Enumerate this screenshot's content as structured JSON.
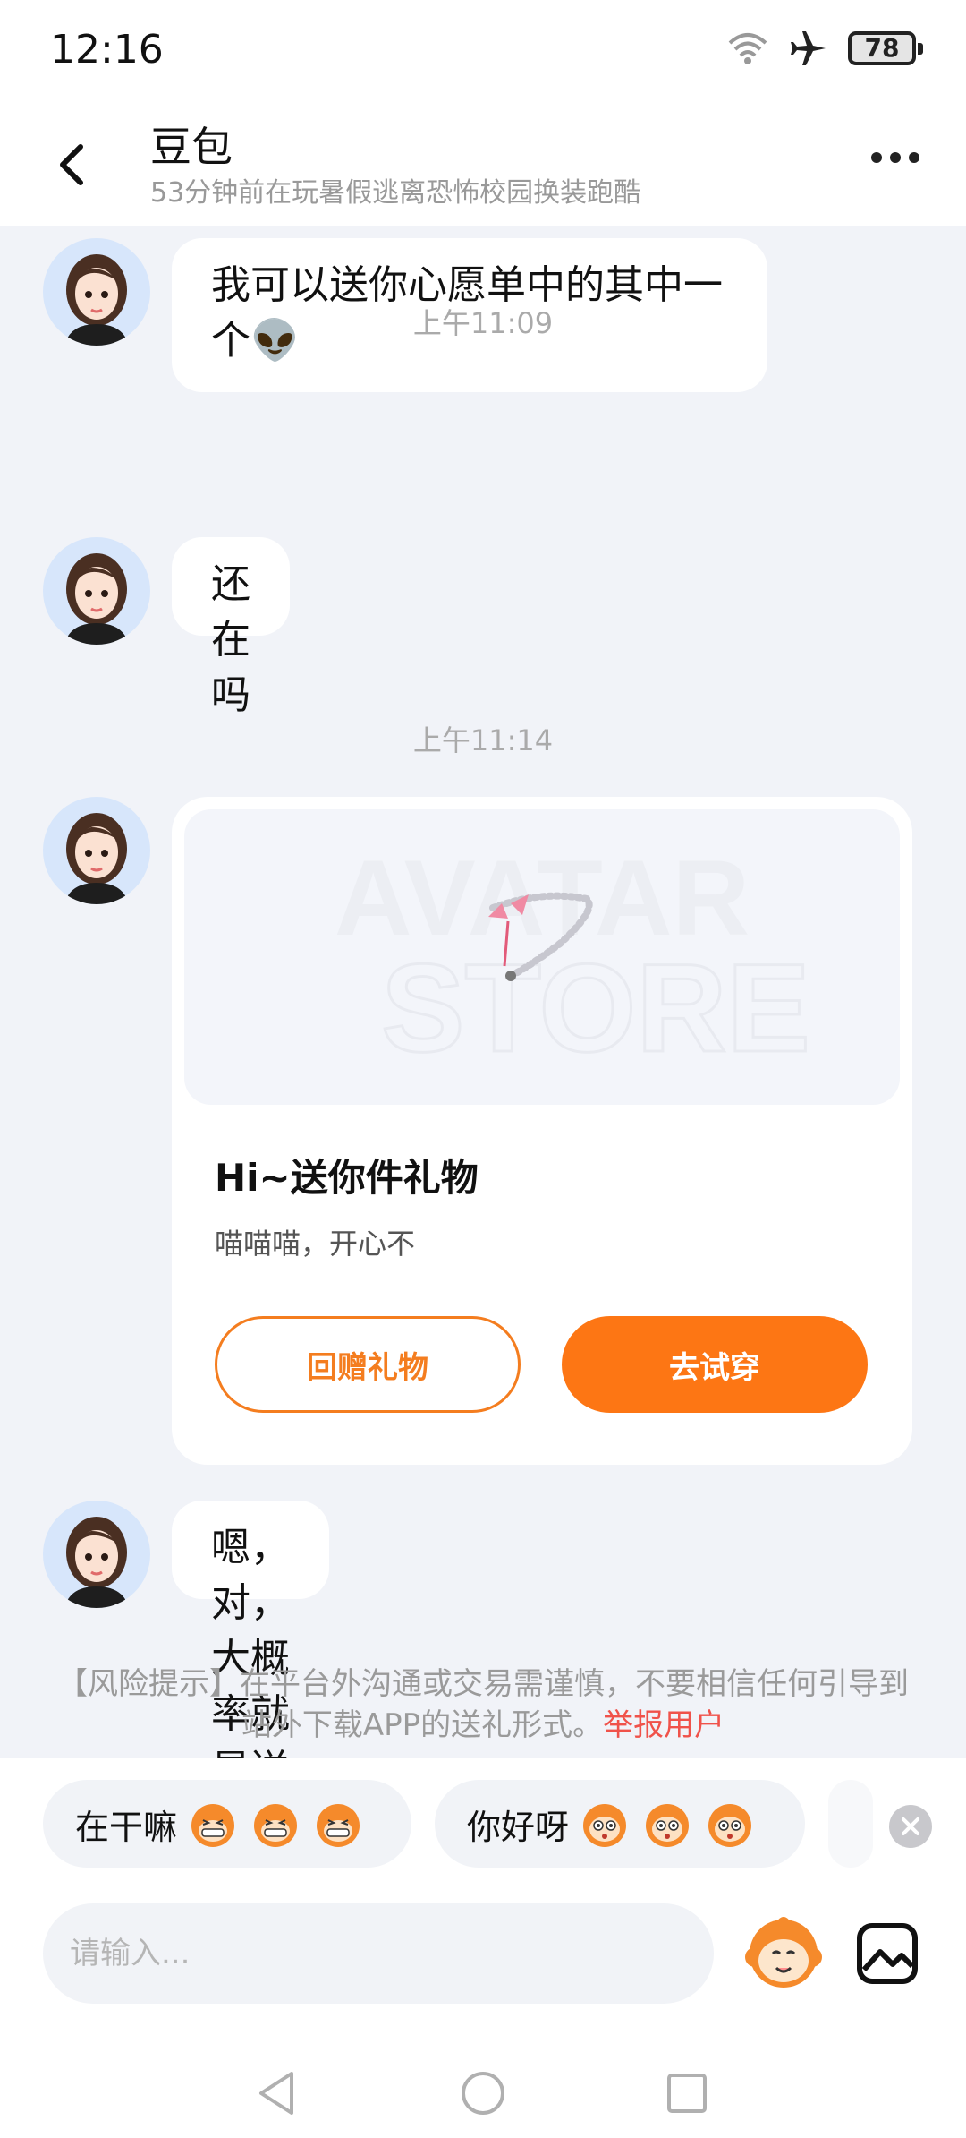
{
  "status_bar": {
    "time": "12:16",
    "battery": "78"
  },
  "header": {
    "title": "豆包",
    "subtitle": "53分钟前在玩暑假逃离恐怖校园换装跑酷"
  },
  "messages": {
    "m1": "我可以送你心愿单中的其中一个👽",
    "ts1": "上午11:09",
    "m2": "还在吗",
    "ts2": "上午11:14",
    "gift_card": {
      "title": "Hi~送你件礼物",
      "subtitle": "喵喵喵，开心不",
      "return_label": "回赠礼物",
      "try_label": "去试穿",
      "watermark_line1": "AVATAR",
      "watermark_line2": "STORE"
    },
    "m3": "嗯，对，大概率就是送了"
  },
  "risk_notice": {
    "text": "【风险提示】在平台外沟通或交易需谨慎，不要相信任何引导到站外下载APP的送礼形式。",
    "link": "举报用户"
  },
  "quick_replies": [
    "在干嘛",
    "你好呀"
  ],
  "input": {
    "placeholder": "请输入..."
  },
  "colors": {
    "accent": "#fd7614",
    "link": "#f0524a",
    "bg": "#f1f3f8"
  }
}
